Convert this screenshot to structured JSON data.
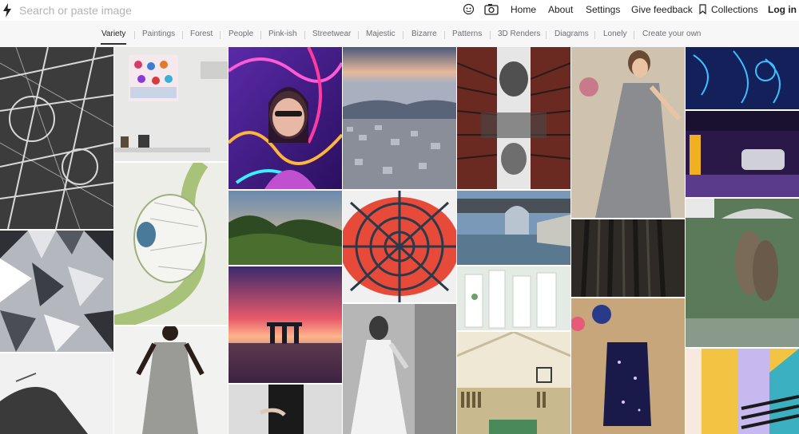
{
  "search": {
    "placeholder": "Search or paste image"
  },
  "header": {
    "home": "Home",
    "about": "About",
    "settings": "Settings",
    "feedback": "Give feedback",
    "collections": "Collections",
    "login": "Log in"
  },
  "categories": [
    "Variety",
    "Paintings",
    "Forest",
    "People",
    "Pink-ish",
    "Streetwear",
    "Majestic",
    "Bizarre",
    "Patterns",
    "3D Renders",
    "Diagrams",
    "Lonely",
    "Create your own"
  ],
  "active_category": "Variety",
  "colors": {
    "accent": "#222222",
    "muted_text": "#6e6e73",
    "category_bg": "#f7f7f8"
  },
  "icons": [
    "bolt-icon",
    "search-icon",
    "camera-icon",
    "bookmark-icon"
  ]
}
